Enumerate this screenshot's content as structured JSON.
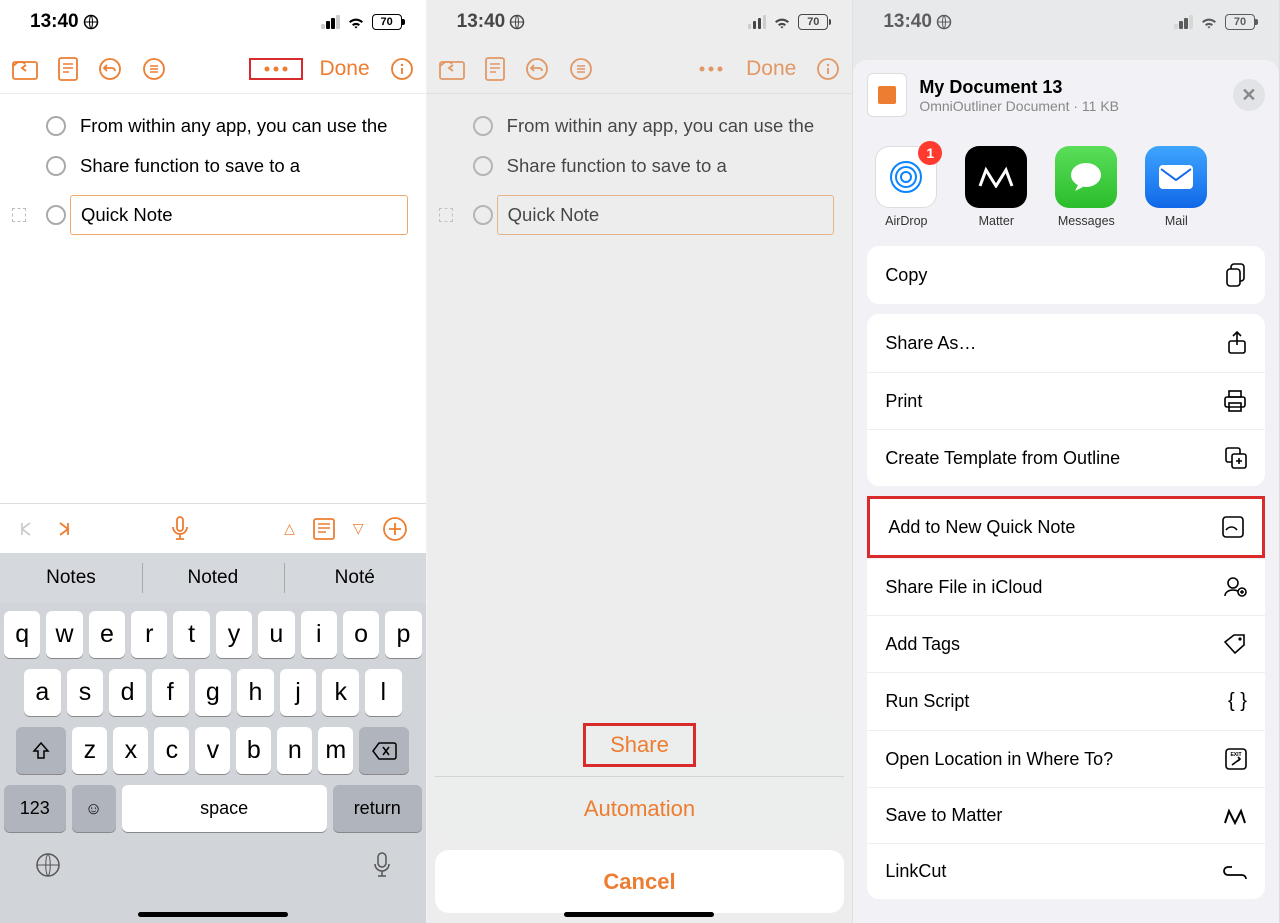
{
  "status": {
    "time": "13:40",
    "battery": "70"
  },
  "panel1": {
    "toolbar": {
      "done": "Done"
    },
    "rows": [
      "From within any app, you can use the",
      "Share function to save to a",
      "Quick Note"
    ],
    "suggestions": [
      "Notes",
      "Noted",
      "Noté"
    ],
    "keys_r1": [
      "q",
      "w",
      "e",
      "r",
      "t",
      "y",
      "u",
      "i",
      "o",
      "p"
    ],
    "keys_r2": [
      "a",
      "s",
      "d",
      "f",
      "g",
      "h",
      "j",
      "k",
      "l"
    ],
    "keys_r3": [
      "z",
      "x",
      "c",
      "v",
      "b",
      "n",
      "m"
    ],
    "space": "space",
    "return": "return",
    "num": "123"
  },
  "panel2": {
    "toolbar": {
      "done": "Done"
    },
    "rows": [
      "From within any app, you can use the",
      "Share function to save to a",
      "Quick Note"
    ],
    "sheet": {
      "share": "Share",
      "automation": "Automation",
      "cancel": "Cancel"
    }
  },
  "panel3": {
    "doc_title": "My Document 13",
    "doc_sub": "OmniOutliner Document · 11 KB",
    "apps": [
      {
        "label": "AirDrop",
        "badge": "1"
      },
      {
        "label": "Matter"
      },
      {
        "label": "Messages"
      },
      {
        "label": "Mail"
      }
    ],
    "actions1": [
      "Copy"
    ],
    "actions2": [
      "Share As…",
      "Print",
      "Create Template from Outline"
    ],
    "actions3": [
      "Add to New Quick Note",
      "Share File in iCloud",
      "Add Tags",
      "Run Script",
      "Open Location in Where To?",
      "Save to Matter",
      "LinkCut"
    ]
  }
}
